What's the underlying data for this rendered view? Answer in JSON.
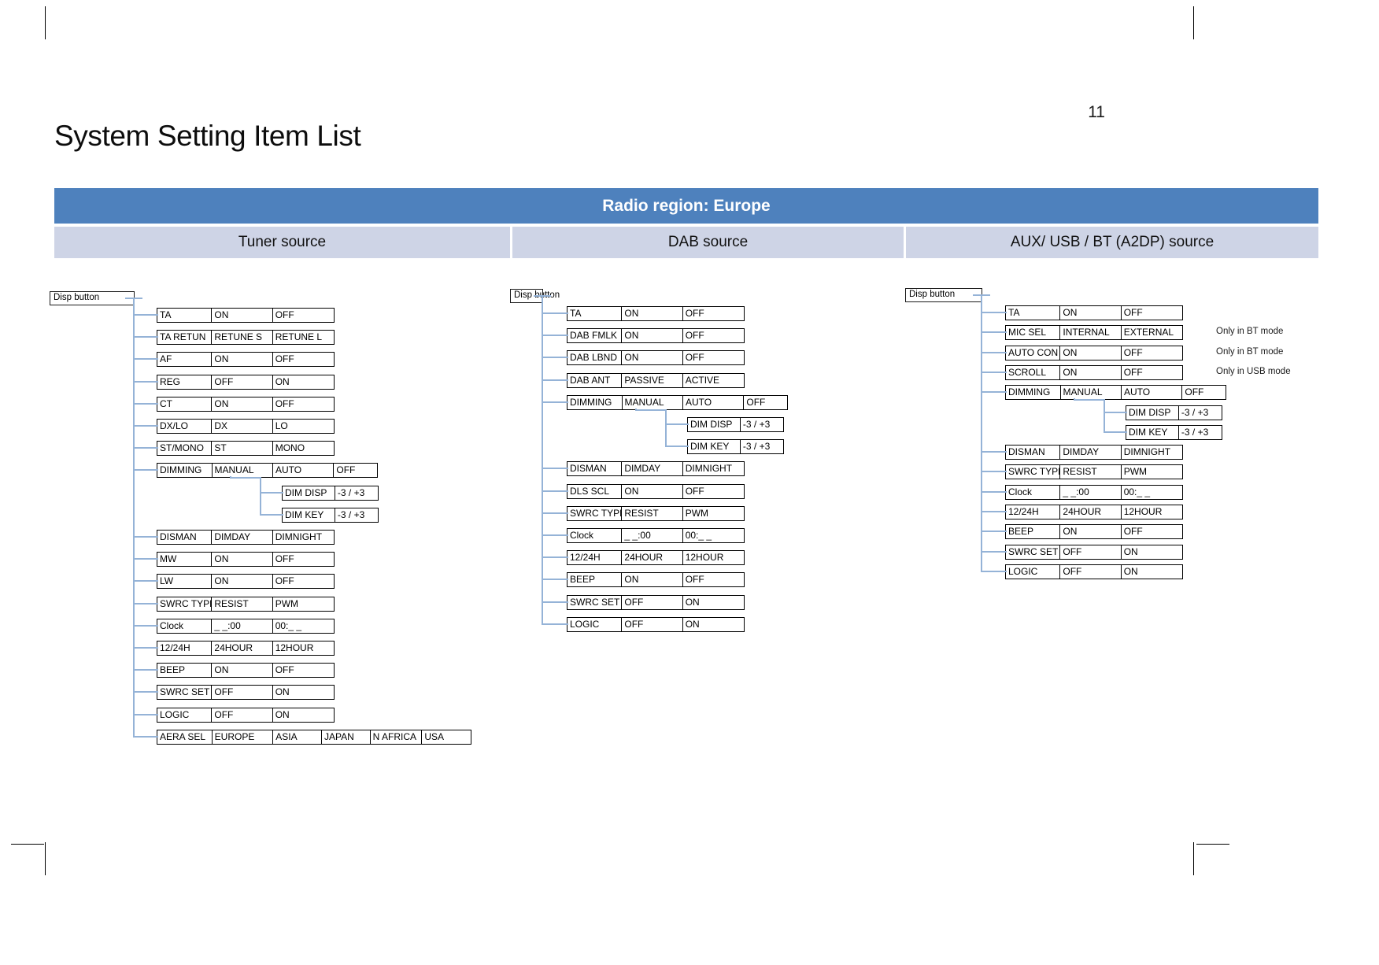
{
  "page": {
    "number": "11",
    "title": "System Setting Item List"
  },
  "table": {
    "region_bar": "Radio region: Europe",
    "columns": [
      {
        "label": "Tuner source"
      },
      {
        "label": "DAB source"
      },
      {
        "label": "AUX/ USB / BT (A2DP) source"
      }
    ]
  },
  "colors": {
    "header_blue": "#4e81bd",
    "subheader_lavender": "#ced4e6",
    "connector_blue": "#95b3d7",
    "box_border": "#000000"
  },
  "trees": {
    "tuner": {
      "root_label": "Disp button",
      "rows": [
        {
          "name": "TA",
          "options": [
            "ON",
            "OFF"
          ]
        },
        {
          "name": "TA RETUN",
          "options": [
            "RETUNE S",
            "RETUNE L"
          ]
        },
        {
          "name": "AF",
          "options": [
            "ON",
            "OFF"
          ]
        },
        {
          "name": "REG",
          "options": [
            "OFF",
            "ON"
          ]
        },
        {
          "name": "CT",
          "options": [
            "ON",
            "OFF"
          ]
        },
        {
          "name": "DX/LO",
          "options": [
            "DX",
            "LO"
          ]
        },
        {
          "name": "ST/MONO",
          "options": [
            "ST",
            "MONO"
          ]
        },
        {
          "name": "DIMMING",
          "options": [
            "MANUAL",
            "AUTO",
            "OFF"
          ]
        },
        {
          "name": "DISMAN",
          "options": [
            "DIMDAY",
            "DIMNIGHT"
          ]
        },
        {
          "name": "MW",
          "options": [
            "ON",
            "OFF"
          ]
        },
        {
          "name": "LW",
          "options": [
            "ON",
            "OFF"
          ]
        },
        {
          "name": "SWRC TYPE",
          "options": [
            "RESIST",
            "PWM"
          ]
        },
        {
          "name": "Clock",
          "options": [
            "_ _:00",
            "00:_ _"
          ]
        },
        {
          "name": "12/24H",
          "options": [
            "24HOUR",
            "12HOUR"
          ]
        },
        {
          "name": "BEEP",
          "options": [
            "ON",
            "OFF"
          ]
        },
        {
          "name": "SWRC SET",
          "options": [
            "OFF",
            "ON"
          ]
        },
        {
          "name": "LOGIC",
          "options": [
            "OFF",
            "ON"
          ]
        },
        {
          "name": "AERA SEL",
          "options": [
            "EUROPE",
            "ASIA",
            "JAPAN",
            "N AFRICA",
            "USA"
          ]
        }
      ],
      "dimming_children": [
        {
          "name": "DIM DISP",
          "options": [
            "-3 / +3"
          ]
        },
        {
          "name": "DIM KEY",
          "options": [
            "-3 / +3"
          ]
        }
      ]
    },
    "dab": {
      "root_label": "Disp button",
      "rows": [
        {
          "name": "TA",
          "options": [
            "ON",
            "OFF"
          ]
        },
        {
          "name": "DAB FMLK",
          "options": [
            "ON",
            "OFF"
          ]
        },
        {
          "name": "DAB LBND",
          "options": [
            "ON",
            "OFF"
          ]
        },
        {
          "name": "DAB ANT",
          "options": [
            "PASSIVE",
            "ACTIVE"
          ]
        },
        {
          "name": "DIMMING",
          "options": [
            "MANUAL",
            "AUTO",
            "OFF"
          ]
        },
        {
          "name": "DISMAN",
          "options": [
            "DIMDAY",
            "DIMNIGHT"
          ]
        },
        {
          "name": "DLS SCL",
          "options": [
            "ON",
            "OFF"
          ]
        },
        {
          "name": "SWRC TYPE",
          "options": [
            "RESIST",
            "PWM"
          ]
        },
        {
          "name": "Clock",
          "options": [
            "_ _:00",
            "00:_ _"
          ]
        },
        {
          "name": "12/24H",
          "options": [
            "24HOUR",
            "12HOUR"
          ]
        },
        {
          "name": "BEEP",
          "options": [
            "ON",
            "OFF"
          ]
        },
        {
          "name": "SWRC SET",
          "options": [
            "OFF",
            "ON"
          ]
        },
        {
          "name": "LOGIC",
          "options": [
            "OFF",
            "ON"
          ]
        }
      ],
      "dimming_children": [
        {
          "name": "DIM DISP",
          "options": [
            "-3 / +3"
          ]
        },
        {
          "name": "DIM KEY",
          "options": [
            "-3 / +3"
          ]
        }
      ]
    },
    "aux": {
      "root_label": "Disp button",
      "rows": [
        {
          "name": "TA",
          "options": [
            "ON",
            "OFF"
          ],
          "note": ""
        },
        {
          "name": "MIC SEL",
          "options": [
            "INTERNAL",
            "EXTERNAL"
          ],
          "note": "Only in BT mode"
        },
        {
          "name": "AUTO CON",
          "options": [
            "ON",
            "OFF"
          ],
          "note": "Only in BT mode"
        },
        {
          "name": "SCROLL",
          "options": [
            "ON",
            "OFF"
          ],
          "note": "Only in USB mode"
        },
        {
          "name": "DIMMING",
          "options": [
            "MANUAL",
            "AUTO",
            "OFF"
          ],
          "note": ""
        },
        {
          "name": "DISMAN",
          "options": [
            "DIMDAY",
            "DIMNIGHT"
          ],
          "note": ""
        },
        {
          "name": "SWRC TYPE",
          "options": [
            "RESIST",
            "PWM"
          ],
          "note": ""
        },
        {
          "name": "Clock",
          "options": [
            "_ _:00",
            "00:_ _"
          ],
          "note": ""
        },
        {
          "name": "12/24H",
          "options": [
            "24HOUR",
            "12HOUR"
          ],
          "note": ""
        },
        {
          "name": "BEEP",
          "options": [
            "ON",
            "OFF"
          ],
          "note": ""
        },
        {
          "name": "SWRC SET",
          "options": [
            "OFF",
            "ON"
          ],
          "note": ""
        },
        {
          "name": "LOGIC",
          "options": [
            "OFF",
            "ON"
          ],
          "note": ""
        }
      ],
      "dimming_children": [
        {
          "name": "DIM DISP",
          "options": [
            "-3 / +3"
          ]
        },
        {
          "name": "DIM KEY",
          "options": [
            "-3 / +3"
          ]
        }
      ]
    }
  }
}
